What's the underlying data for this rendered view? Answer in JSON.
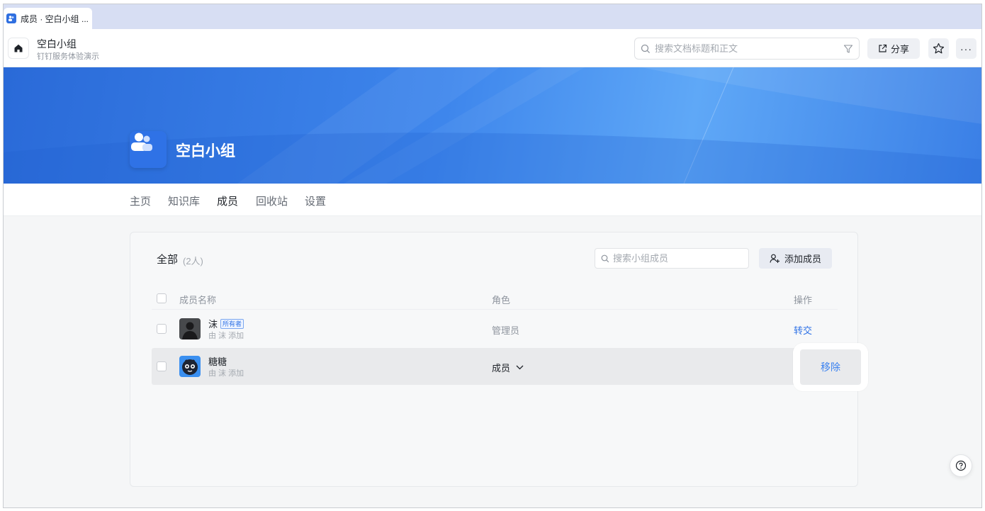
{
  "tab": {
    "title": "成员 · 空白小组 ..."
  },
  "toolbar": {
    "workspace_name": "空白小组",
    "workspace_sub": "钉钉服务体验演示",
    "search_placeholder": "搜索文档标题和正文",
    "share_label": "分享"
  },
  "banner": {
    "group_title": "空白小组"
  },
  "nav": {
    "items": [
      "主页",
      "知识库",
      "成员",
      "回收站",
      "设置"
    ],
    "active": "成员"
  },
  "members": {
    "title": "全部",
    "count": "(2人)",
    "search_placeholder": "搜索小组成员",
    "add_label": "添加成员",
    "columns": {
      "name": "成员名称",
      "role": "角色",
      "action": "操作"
    },
    "rows": [
      {
        "name": "沫",
        "tag": "所有者",
        "added_by": "由 沫 添加",
        "role": "管理员",
        "action": "转交"
      },
      {
        "name": "糖糖",
        "tag": "",
        "added_by": "由 沫 添加",
        "role": "成员",
        "action": "移除"
      }
    ]
  },
  "icons": {
    "home": "home-icon",
    "search": "search-icon",
    "filter": "filter-icon",
    "share": "share-icon",
    "star": "star-icon",
    "more": "more-icon",
    "group": "group-icon",
    "add_user": "add-user-icon",
    "chevron": "chevron-down-icon",
    "help": "help-icon"
  },
  "colors": {
    "accent": "#2f72e6",
    "banner": "#3e86ec",
    "link": "#2f72e6"
  }
}
